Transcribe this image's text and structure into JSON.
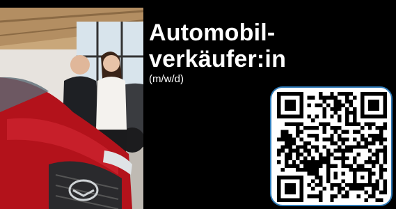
{
  "ad": {
    "title_line1": "Automobil-",
    "title_line2": "verkäufer:in",
    "subtitle": "(m/w/d)"
  },
  "image": {
    "photo_alt": "Two people standing next to a red car in a showroom",
    "qr_icon": "qr-code-icon"
  },
  "colors": {
    "background": "#000000",
    "text": "#ffffff",
    "qr_border": "#2e7ab8",
    "car_red": "#b3121b"
  }
}
